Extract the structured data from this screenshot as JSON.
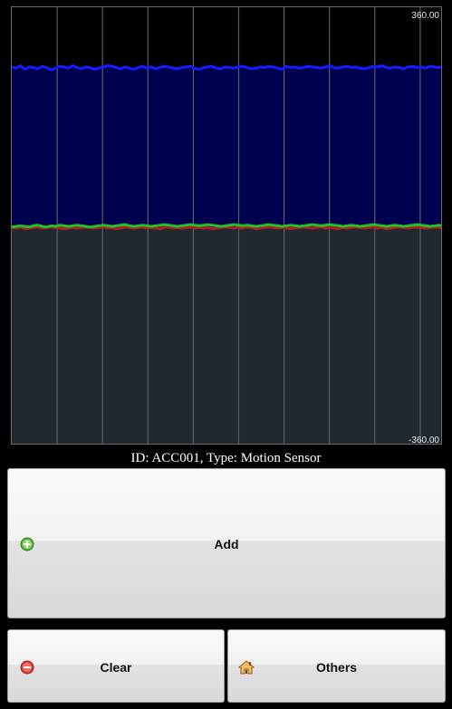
{
  "chart": {
    "y_max_label": "360.00",
    "y_min_label": "-360.00"
  },
  "chart_data": {
    "type": "line",
    "ylim": [
      -360,
      360
    ],
    "grid": true,
    "series": [
      {
        "color": "#1a1aff",
        "fill": "#000050",
        "values": [
          262,
          260,
          264,
          258,
          262,
          261,
          259,
          263,
          261,
          257,
          260,
          263,
          262,
          260,
          264,
          261,
          259,
          262,
          261,
          258,
          260,
          262,
          264,
          263,
          261,
          259,
          262,
          260,
          258,
          261,
          263,
          260,
          262,
          259,
          261,
          263,
          262,
          260,
          259,
          261,
          262,
          263,
          260,
          258,
          261,
          262,
          263,
          260,
          259,
          262,
          261,
          260,
          262,
          263,
          261,
          259,
          260,
          262,
          261,
          263,
          262,
          260,
          258,
          263,
          261,
          262,
          260,
          261,
          263,
          262,
          261,
          260,
          262,
          264,
          261,
          260,
          262,
          263,
          261,
          262,
          260,
          259,
          261,
          263,
          262,
          264,
          261,
          260,
          262,
          261,
          259,
          262,
          263,
          261,
          262,
          260,
          263,
          262,
          261,
          262
        ]
      },
      {
        "color": "#b02020",
        "values": [
          -2,
          -3,
          -1,
          -4,
          -3,
          -2,
          -1,
          -3,
          -2,
          -1,
          -2,
          -3,
          -4,
          -3,
          -2,
          -3,
          -2,
          -1,
          -2,
          -3,
          -2,
          -1,
          -3,
          -2,
          -4,
          -3,
          -1,
          -2,
          -3,
          -2,
          -1,
          -3,
          -2,
          -3,
          -4,
          -2,
          -1,
          -3,
          -2,
          -3,
          -2,
          -1,
          -3,
          -2,
          -3,
          -2,
          -4,
          -3,
          -2,
          -1,
          -2,
          -3,
          -2,
          -3,
          -1,
          -2,
          -4,
          -3,
          -2,
          -1,
          -2,
          -3,
          -2,
          -3,
          -4,
          -3,
          -2,
          -1,
          -2,
          -3,
          -2,
          -1,
          -3,
          -2,
          -3,
          -4,
          -2,
          -3,
          -2,
          -1,
          -2,
          -3,
          -2,
          -1,
          -3,
          -2,
          -4,
          -3,
          -2,
          -1,
          -2,
          -3,
          -2,
          -1,
          -2,
          -3,
          -2,
          -1,
          -2,
          -3
        ]
      },
      {
        "color": "#22c22a",
        "fill": "#202830",
        "values": [
          -1,
          0,
          1,
          0,
          -1,
          1,
          2,
          0,
          -1,
          1,
          0,
          2,
          1,
          0,
          1,
          2,
          1,
          0,
          -1,
          0,
          1,
          2,
          1,
          0,
          1,
          2,
          3,
          1,
          0,
          1,
          2,
          1,
          0,
          1,
          2,
          3,
          2,
          1,
          0,
          1,
          2,
          3,
          2,
          1,
          2,
          3,
          2,
          1,
          0,
          1,
          2,
          3,
          2,
          1,
          2,
          1,
          0,
          1,
          2,
          3,
          2,
          1,
          0,
          1,
          2,
          1,
          0,
          1,
          2,
          3,
          2,
          1,
          2,
          3,
          2,
          1,
          0,
          1,
          2,
          1,
          0,
          1,
          2,
          3,
          2,
          1,
          0,
          1,
          2,
          1,
          0,
          1,
          2,
          3,
          2,
          1,
          0,
          1,
          2,
          1
        ]
      }
    ]
  },
  "status": {
    "caption": "ID: ACC001, Type: Motion Sensor"
  },
  "buttons": {
    "add": "Add",
    "clear": "Clear",
    "others": "Others"
  },
  "icons": {
    "add": "add-circle-icon",
    "clear": "remove-circle-icon",
    "others": "home-icon"
  }
}
